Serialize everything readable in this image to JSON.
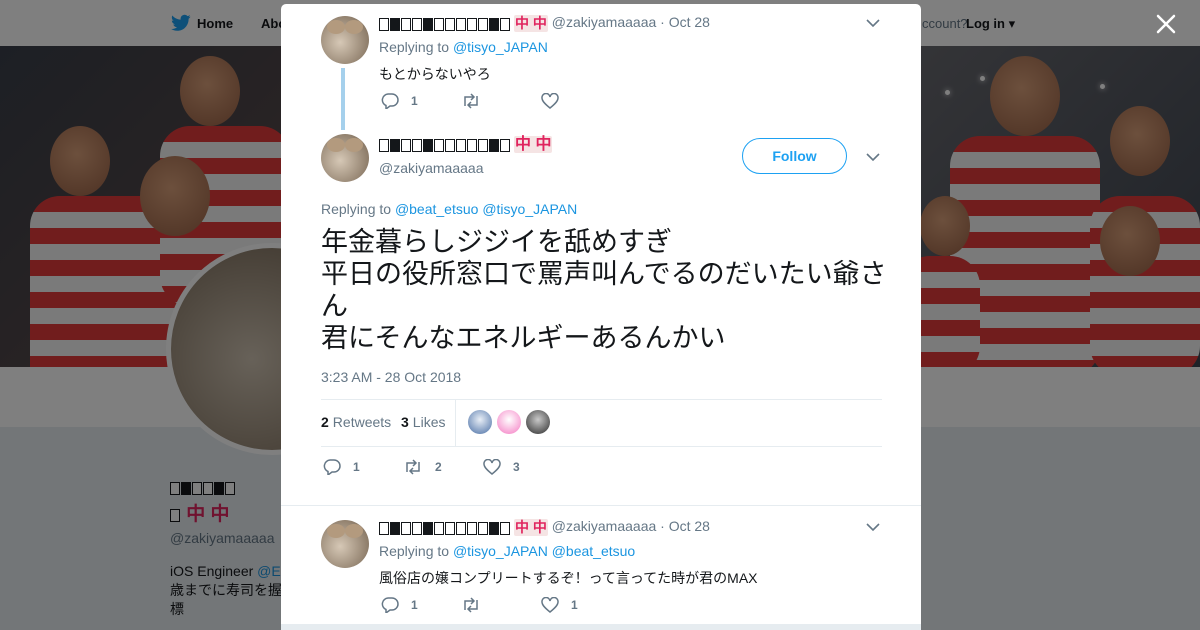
{
  "nav": {
    "home_label": "Home",
    "about_label": "Abo",
    "account_text": "ccount?",
    "login_label": "Log in"
  },
  "profile": {
    "handle": "@zakiyamaaaaa",
    "name_red": "中 中",
    "bio_prefix": "iOS Engineer ",
    "bio_link": "@E",
    "bio_line2": "歳までに寿司を握",
    "bio_line3": "標"
  },
  "tweets": [
    {
      "name_red": "中 中",
      "handle": "@zakiyamaaaaa",
      "date": "· Oct 28",
      "replying_label": "Replying to",
      "mentions": "@tisyo_JAPAN",
      "text": "もとからないやろ",
      "replies": "1",
      "retweets": "",
      "likes": ""
    },
    {
      "name_red": "中 中",
      "handle": "@zakiyamaaaaa",
      "date": "· Oct 28",
      "replying_label": "Replying to",
      "mentions": "@tisyo_JAPAN @beat_etsuo",
      "text": "風俗店の嬢コンプリートするぞ！って言ってた時が君のMAX",
      "replies": "1",
      "retweets": "",
      "likes": "1"
    }
  ],
  "main_tweet": {
    "name_red": "中 中",
    "handle": "@zakiyamaaaaa",
    "follow_label": "Follow",
    "replying_label": "Replying to",
    "mentions": "@beat_etsuo @tisyo_JAPAN",
    "text": "年金暮らしジジイを舐めすぎ\n平日の役所窓口で罵声叫んでるのだいたい爺さん\n君にそんなエネルギーあるんかい",
    "timestamp": "3:23 AM - 28 Oct 2018",
    "retweets_count": "2",
    "retweets_label": "Retweets",
    "likes_count": "3",
    "likes_label": "Likes",
    "replies": "1",
    "retweets": "2",
    "likes": "3"
  },
  "icons": {
    "close": "close-icon",
    "reply": "reply-icon",
    "retweet": "retweet-icon",
    "like": "heart-icon",
    "chevron": "chevron-down-icon",
    "twitter": "twitter-bird-icon"
  },
  "colors": {
    "accent": "#1da1f2",
    "link": "#1b95e0",
    "text": "#14171a",
    "muted": "#657786",
    "mahjong_red": "#e0245e"
  }
}
